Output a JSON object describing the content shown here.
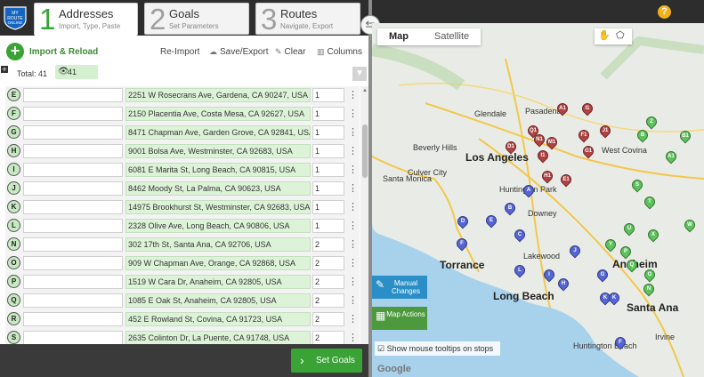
{
  "app": {
    "logo_text": "MY ROUTE ONLINE",
    "help_label": "?"
  },
  "steps": [
    {
      "num": "1",
      "title": "Addresses",
      "sub": "Import, Type, Paste"
    },
    {
      "num": "2",
      "title": "Goals",
      "sub": "Set Parameters"
    },
    {
      "num": "3",
      "title": "Routes",
      "sub": "Navigate, Export"
    }
  ],
  "toolbar": {
    "import_label": "Import & Reload",
    "reimport_label": "Re-Import",
    "save_label": "Save/Export",
    "clear_label": "Clear",
    "columns_label": "Columns"
  },
  "summary": {
    "total_label": "Total: 41",
    "visible_count": "41"
  },
  "rows": [
    {
      "letter": "E",
      "name": "",
      "address": "2251 W Rosecrans Ave, Gardena, CA 90247, USA",
      "qty": "1"
    },
    {
      "letter": "F",
      "name": "",
      "address": "2150 Placentia Ave, Costa Mesa, CA 92627, USA",
      "qty": "1"
    },
    {
      "letter": "G",
      "name": "",
      "address": "8471 Chapman Ave, Garden Grove, CA 92841, USA",
      "qty": "1"
    },
    {
      "letter": "H",
      "name": "",
      "address": "9001 Bolsa Ave, Westminster, CA 92683, USA",
      "qty": "1"
    },
    {
      "letter": "I",
      "name": "",
      "address": "6081 E Marita St, Long Beach, CA 90815, USA",
      "qty": "1"
    },
    {
      "letter": "J",
      "name": "",
      "address": "8462 Moody St, La Palma, CA 90623, USA",
      "qty": "1"
    },
    {
      "letter": "K",
      "name": "",
      "address": "14975 Brookhurst St, Westminster, CA 92683, USA",
      "qty": "1"
    },
    {
      "letter": "L",
      "name": "",
      "address": "2328 Olive Ave, Long Beach, CA 90806, USA",
      "qty": "1"
    },
    {
      "letter": "N",
      "name": "",
      "address": "302 17th St, Santa Ana, CA 92706, USA",
      "qty": "2"
    },
    {
      "letter": "O",
      "name": "",
      "address": "909 W Chapman Ave, Orange, CA 92868, USA",
      "qty": "2"
    },
    {
      "letter": "P",
      "name": "",
      "address": "1519 W Cara Dr, Anaheim, CA 92805, USA",
      "qty": "2"
    },
    {
      "letter": "Q",
      "name": "",
      "address": "1085 E Oak St, Anaheim, CA 92805, USA",
      "qty": "2"
    },
    {
      "letter": "R",
      "name": "",
      "address": "452 E Rowland St, Covina, CA 91723, USA",
      "qty": "2"
    },
    {
      "letter": "S",
      "name": "",
      "address": "2635 Colinton Dr, La Puente, CA 91748, USA",
      "qty": "2"
    }
  ],
  "footer": {
    "set_goals_label": "Set Goals"
  },
  "map": {
    "type_map": "Map",
    "type_satellite": "Satellite",
    "manual_changes": "Manual Changes",
    "map_actions": "Map Actions",
    "tooltips_label": "Show mouse tooltips on stops",
    "google": "Google",
    "cities": [
      {
        "name": "Glendale",
        "big": false
      },
      {
        "name": "Pasadena",
        "big": false
      },
      {
        "name": "Beverly Hills",
        "big": false
      },
      {
        "name": "Los Angeles",
        "big": true
      },
      {
        "name": "West Covina",
        "big": false
      },
      {
        "name": "Santa Monica",
        "big": false
      },
      {
        "name": "Culver City",
        "big": false
      },
      {
        "name": "Huntington Park",
        "big": false
      },
      {
        "name": "Downey",
        "big": false
      },
      {
        "name": "Torrance",
        "big": true
      },
      {
        "name": "Lakewood",
        "big": false
      },
      {
        "name": "Long Beach",
        "big": true
      },
      {
        "name": "Anaheim",
        "big": true
      },
      {
        "name": "Santa Ana",
        "big": true
      },
      {
        "name": "Irvine",
        "big": false
      },
      {
        "name": "Huntington Beach",
        "big": false
      }
    ]
  }
}
